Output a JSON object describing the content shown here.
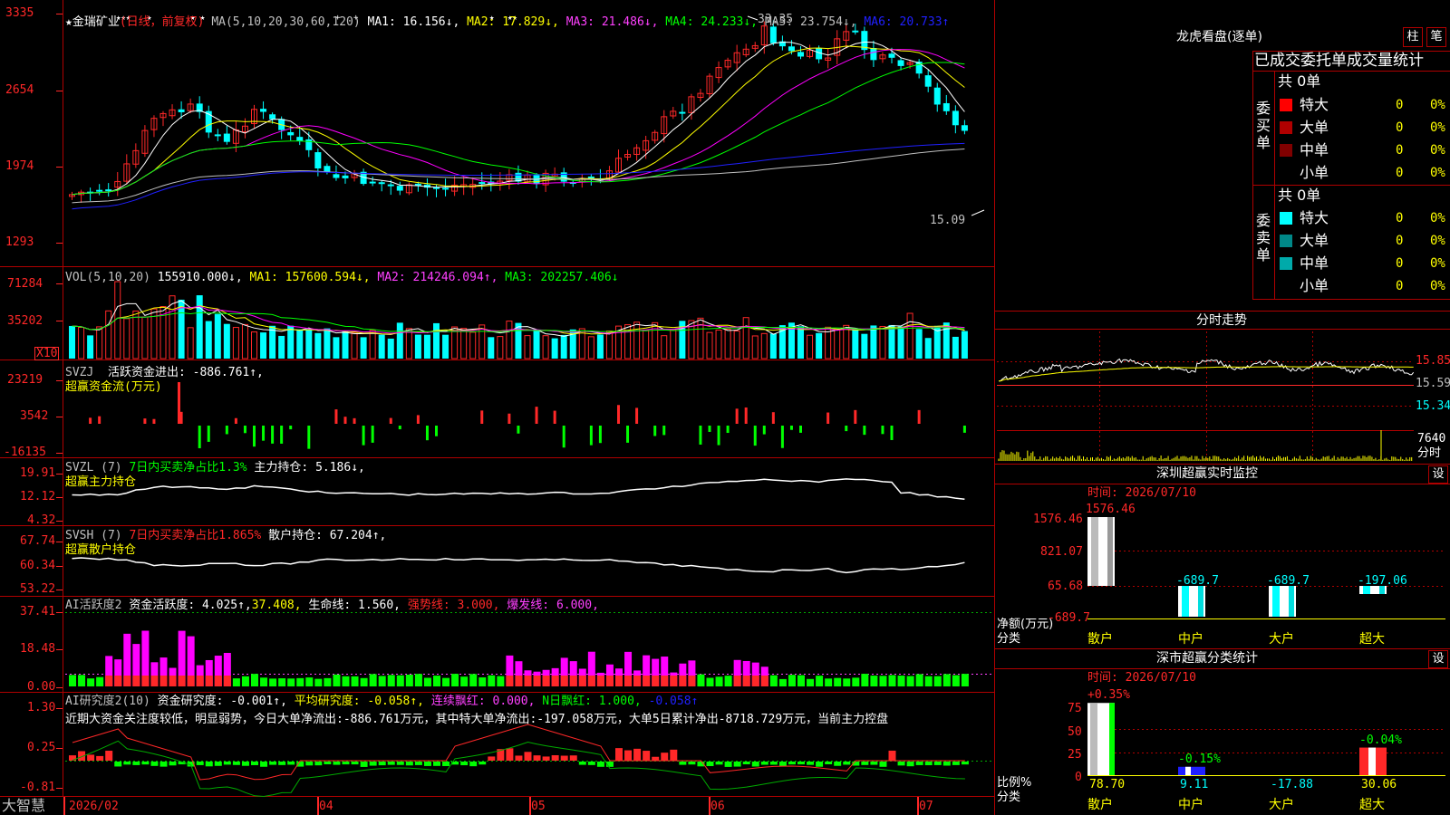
{
  "colors": {
    "up": "#ff2828",
    "down": "#00ffff",
    "grid": "#b00000",
    "ma1": "#ffffff",
    "ma2": "#ffff00",
    "ma3": "#ff00ff",
    "ma4": "#00ff00",
    "ma5": "#c0c0c0",
    "ma6": "#2020ff"
  },
  "main": {
    "price_axis": [
      "3335",
      "2654",
      "1974",
      "1293"
    ],
    "header": {
      "star": "★",
      "name": "金瑞矿业",
      "mode": "(日线，前复权)",
      "ma_def": "MA(5,10,20,30,60,120)",
      "ma1": "MA1: 16.156↓,",
      "ma2": "MA2: 17.829↓,",
      "ma3": "MA3: 21.486↓,",
      "ma4": "MA4: 24.233↓,",
      "ma5": "MA5: 23.754↓,",
      "ma6": "MA6: 20.733↑"
    },
    "high_label": "33.35",
    "low_label": "15.09"
  },
  "vol": {
    "axis": [
      "71284",
      "35202"
    ],
    "unit": "X10",
    "header": {
      "def": "VOL(5,10,20)",
      "value": "155910.000↓,",
      "ma1": "MA1: 157600.594↓,",
      "ma2": "MA2: 214246.094↑,",
      "ma3": "MA3: 202257.406↓"
    }
  },
  "svzj": {
    "axis": [
      "23219",
      "3542",
      "-16135"
    ],
    "header": {
      "name": "SVZJ",
      "label": "活跃资金进出: -886.761↑,",
      "sub": "超赢资金流(万元)"
    }
  },
  "svzl": {
    "axis": [
      "19.91",
      "12.12",
      "4.32"
    ],
    "header": {
      "name": "SVZL (7)",
      "ratio": "7日内买卖净占比1.3%",
      "label": "主力持仓: 5.186↓,",
      "sub": "超赢主力持仓"
    }
  },
  "svsh": {
    "axis": [
      "67.74",
      "60.34",
      "53.22"
    ],
    "header": {
      "name": "SVSH (7)",
      "ratio": "7日内买卖净占比1.865%",
      "label": "散户持仓: 67.204↑,",
      "sub": "超赢散户持仓"
    }
  },
  "ai1": {
    "axis": [
      "37.41",
      "18.48",
      "0.00"
    ],
    "header": {
      "name": "AI活跃度2",
      "label": "资金活跃度: 4.025↑,",
      "val2": "37.408,",
      "life": "生命线: 1.560,",
      "strong": "强势线: 3.000,",
      "burst": "爆发线: 6.000,"
    }
  },
  "ai2": {
    "axis": [
      "1.30",
      "0.25",
      "-0.81"
    ],
    "header": {
      "name": "AI研究度2(10)",
      "label": "资金研究度: -0.001↑,",
      "avg": "平均研究度: -0.058↑,",
      "red": "连续飘红: 0.000,",
      "nred": "N日飘红: 1.000,",
      "v": "-0.058↑"
    },
    "comment": "近期大资金关注度较低，明显弱势，今日大单净流出:-886.761万元，其中特大单净流出:-197.058万元，大单5日累计净出-8718.729万元，当前主力控盘"
  },
  "xaxis": {
    "brand": "大智慧",
    "labels": [
      "2026/02",
      "04",
      "05",
      "06",
      "07"
    ]
  },
  "lhb": {
    "title": "龙虎看盘(逐单)",
    "btn1": "柱",
    "btn2": "笔",
    "subtitle": "已成交委托单成交量统计",
    "buy": {
      "side": "委买单",
      "total": "共 0单",
      "rows": [
        {
          "label": "特大",
          "count": "0",
          "pct": "0%"
        },
        {
          "label": "大单",
          "count": "0",
          "pct": "0%"
        },
        {
          "label": "中单",
          "count": "0",
          "pct": "0%"
        },
        {
          "label": "小单",
          "count": "0",
          "pct": "0%"
        }
      ]
    },
    "sell": {
      "side": "委卖单",
      "total": "共 0单",
      "rows": [
        {
          "label": "特大",
          "count": "0",
          "pct": "0%"
        },
        {
          "label": "大单",
          "count": "0",
          "pct": "0%"
        },
        {
          "label": "中单",
          "count": "0",
          "pct": "0%"
        },
        {
          "label": "小单",
          "count": "0",
          "pct": "0%"
        }
      ]
    }
  },
  "intraday": {
    "title": "分时走势",
    "prices": [
      "15.85",
      "15.59",
      "15.34"
    ],
    "vol_label": "7640",
    "vol_unit": "分时"
  },
  "monitor": {
    "title": "深圳超赢实时监控",
    "btn": "设",
    "time": "时间: 2026/07/10",
    "axis": [
      "1576.46",
      "821.07",
      "65.68",
      "-689.7"
    ],
    "ylabel": "净额(万元)",
    "xlabel": "分类",
    "bars": [
      {
        "cat": "散户",
        "value": 1576.46,
        "label": "1576.46"
      },
      {
        "cat": "中户",
        "value": -689.7,
        "label": "-689.7"
      },
      {
        "cat": "大户",
        "value": -689.7,
        "label": "-689.7"
      },
      {
        "cat": "超大",
        "value": -197.06,
        "label": "-197.06"
      }
    ]
  },
  "classify": {
    "title": "深市超赢分类统计",
    "btn": "设",
    "time": "时间: 2026/07/10",
    "axis": [
      "75",
      "50",
      "25",
      "0"
    ],
    "ylabel": "比例%",
    "xlabel": "分类",
    "bars": [
      {
        "cat": "散户",
        "change": "+0.35%",
        "value": "78.70",
        "pct": 78.7
      },
      {
        "cat": "中户",
        "change": "-0.15%",
        "value": "9.11",
        "pct": 9.11
      },
      {
        "cat": "大户",
        "change": "",
        "value": "-17.88",
        "pct": 0
      },
      {
        "cat": "超大",
        "change": "-0.04%",
        "value": "30.06",
        "pct": 30.06
      }
    ]
  }
}
